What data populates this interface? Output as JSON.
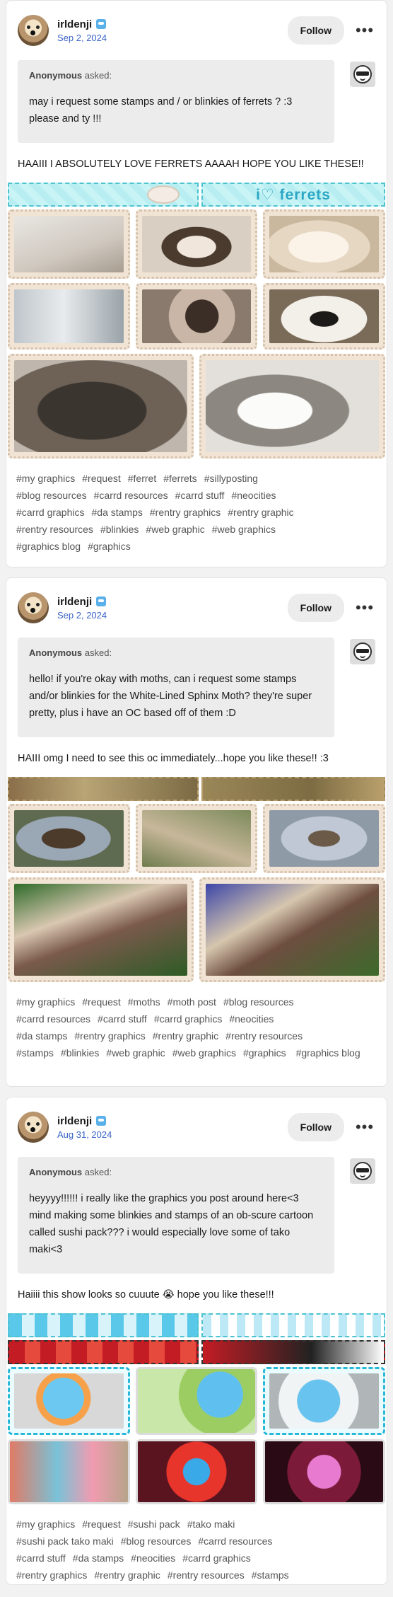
{
  "posts": [
    {
      "username": "irldenji",
      "date": "Sep 2, 2024",
      "follow_label": "Follow",
      "asker": "Anonymous",
      "asked_label": "asked:",
      "question": "may i request some stamps and / or blinkies of ferrets ? :3 please and ty !!!",
      "answer": "HAAIII I ABSOLUTELY LOVE FERRETS AAAAH HOPE YOU LIKE THESE!!",
      "blinkie_text": "i♡ ferrets",
      "tags": [
        "#my graphics",
        "#request",
        "#ferret",
        "#ferrets",
        "#sillyposting",
        "#blog resources",
        "#carrd resources",
        "#carrd stuff",
        "#neocities",
        "#carrd graphics",
        "#da stamps",
        "#rentry graphics",
        "#rentry graphic",
        "#rentry resources",
        "#blinkies",
        "#web graphic",
        "#web graphics",
        "#graphics blog",
        "#graphics"
      ]
    },
    {
      "username": "irldenji",
      "date": "Sep 2, 2024",
      "follow_label": "Follow",
      "asker": "Anonymous",
      "asked_label": "asked:",
      "question": "hello! if you're okay with moths, can i request some stamps and/or blinkies for the White-Lined Sphinx Moth? they're super pretty, plus i have an OC based off of them :D",
      "answer": "HAIII omg I need to see this oc immediately...hope you like these!! :3",
      "tags": [
        "#my graphics",
        "#request",
        "#moths",
        "#moth post",
        "#blog resources",
        "#carrd resources",
        "#carrd stuff",
        "#carrd graphics",
        "#neocities",
        "#da stamps",
        "#rentry graphics",
        "#rentry graphic",
        "#rentry resources",
        "#stamps",
        "#blinkies",
        "#web graphic",
        "#web graphics",
        "#graphics",
        "#graphics blog"
      ]
    },
    {
      "username": "irldenji",
      "date": "Aug 31, 2024",
      "follow_label": "Follow",
      "asker": "Anonymous",
      "asked_label": "asked:",
      "question": "heyyyy!!!!!! i really like the graphics you post around here<3 mind making some blinkies and stamps of an ob-scure cartoon called sushi pack??? i would especially love some of tako maki<3",
      "answer": "Haiiii this show looks so cuuute 😭 hope you like these!!!",
      "tags": [
        "#my graphics",
        "#request",
        "#sushi pack",
        "#tako maki",
        "#sushi pack tako maki",
        "#blog resources",
        "#carrd resources",
        "#carrd stuff",
        "#da stamps",
        "#neocities",
        "#carrd graphics",
        "#rentry graphics",
        "#rentry graphic",
        "#rentry resources",
        "#stamps"
      ]
    }
  ],
  "icons": {
    "badge": "blue-badge-icon",
    "more": "more-options-icon",
    "anon": "anonymous-sunglasses-avatar"
  }
}
